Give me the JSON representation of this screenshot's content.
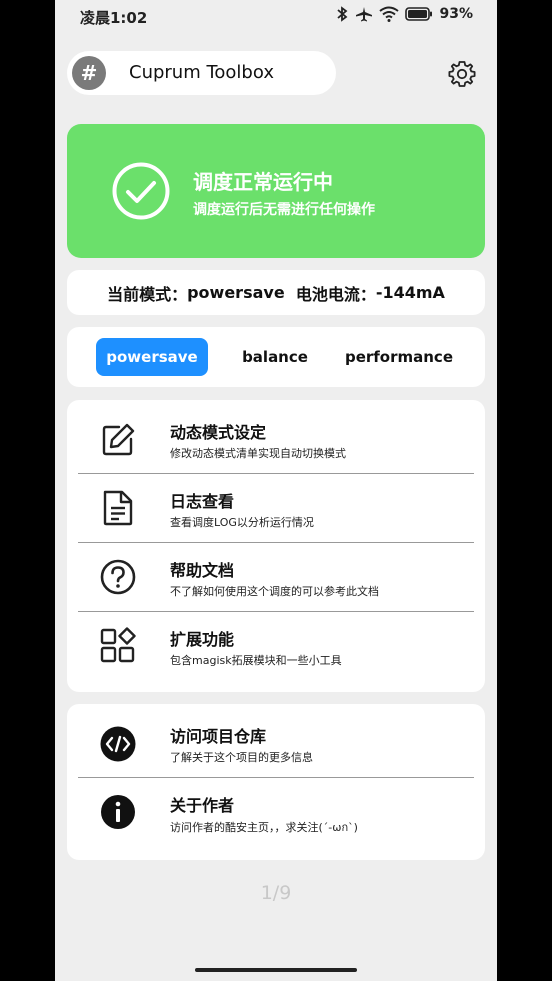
{
  "status_bar": {
    "time": "凌晨1:02",
    "battery": "93%"
  },
  "header": {
    "app_icon_glyph": "#",
    "title": "Cuprum Toolbox"
  },
  "status_card": {
    "title": "调度正常运行中",
    "subtitle": "调度运行后无需进行任何操作",
    "color": "#6be06b"
  },
  "info": {
    "mode_label": "当前模式：",
    "mode_value": "powersave",
    "current_label": "电池电流：",
    "current_value": "-144mA"
  },
  "modes": [
    {
      "label": "powersave",
      "active": true
    },
    {
      "label": "balance",
      "active": false
    },
    {
      "label": "performance",
      "active": false
    }
  ],
  "menu_main": [
    {
      "icon": "edit-icon",
      "title": "动态模式设定",
      "desc": "修改动态模式清单实现自动切换模式"
    },
    {
      "icon": "log-file-icon",
      "title": "日志查看",
      "desc": "查看调度LOG以分析运行情况"
    },
    {
      "icon": "help-icon",
      "title": "帮助文档",
      "desc": "不了解如何使用这个调度的可以参考此文档"
    },
    {
      "icon": "apps-icon",
      "title": "扩展功能",
      "desc": "包含magisk拓展模块和一些小工具"
    }
  ],
  "menu_secondary": [
    {
      "icon": "code-icon",
      "title": "访问项目仓库",
      "desc": "了解关于这个项目的更多信息"
    },
    {
      "icon": "info-icon",
      "title": "关于作者",
      "desc": "访问作者的酷安主页，，求关注(´-ωก`)"
    }
  ],
  "page_indicator": "1/9",
  "accent_color": "#1e90ff"
}
